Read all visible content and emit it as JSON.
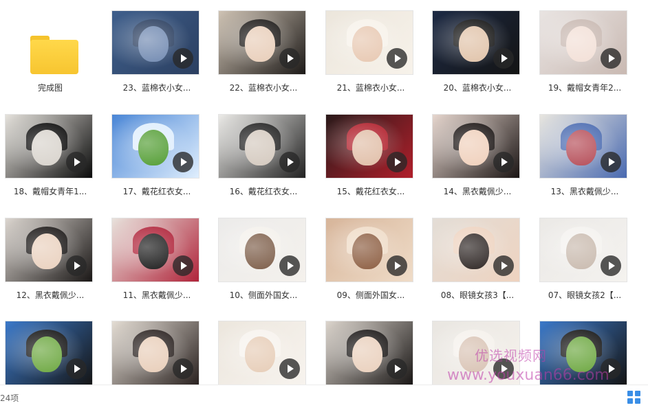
{
  "items": [
    {
      "label": "完成图",
      "kind": "folder",
      "icon": "folder-icon",
      "colors": [
        "#ffd84a"
      ]
    },
    {
      "label": "23、蓝棉衣小女...",
      "kind": "video",
      "icon": "play-icon",
      "colors": [
        "#3f5f8c",
        "#6f88b0",
        "#2b3f60"
      ]
    },
    {
      "label": "22、蓝棉衣小女...",
      "kind": "video",
      "icon": "play-icon",
      "colors": [
        "#cfc3b4",
        "#e8cdb8",
        "#1d1a18"
      ]
    },
    {
      "label": "21、蓝棉衣小女...",
      "kind": "video",
      "icon": "play-icon",
      "colors": [
        "#ece6dc",
        "#e7c7b0",
        "#f7f2ea"
      ]
    },
    {
      "label": "20、蓝棉衣小女...",
      "kind": "video",
      "icon": "play-icon",
      "colors": [
        "#1d2a44",
        "#e0c2a8",
        "#141414"
      ]
    },
    {
      "label": "19、戴帽女青年2...",
      "kind": "video",
      "icon": "play-icon",
      "colors": [
        "#e9e4e2",
        "#f2dfd6",
        "#c9b9b2"
      ]
    },
    {
      "label": "18、戴帽女青年1...",
      "kind": "video",
      "icon": "play-icon",
      "colors": [
        "#e6e3dd",
        "#d7d2cb",
        "#0b0b0b"
      ]
    },
    {
      "label": "17、戴花红衣女...",
      "kind": "video",
      "icon": "play-icon",
      "colors": [
        "#4a86d6",
        "#4f9b2f",
        "#dfeefd"
      ]
    },
    {
      "label": "16、戴花红衣女...",
      "kind": "video",
      "icon": "play-icon",
      "colors": [
        "#ecebe8",
        "#d3c8bd",
        "#222222"
      ]
    },
    {
      "label": "15、戴花红衣女...",
      "kind": "video",
      "icon": "play-icon",
      "colors": [
        "#2a1a1a",
        "#e0bda6",
        "#b01f2b"
      ]
    },
    {
      "label": "14、黑衣戴佩少...",
      "kind": "video",
      "icon": "play-icon",
      "colors": [
        "#e7d7cf",
        "#efcfba",
        "#1b1514"
      ]
    },
    {
      "label": "13、黑衣戴佩少...",
      "kind": "video",
      "icon": "play-icon",
      "colors": [
        "#e8e6e0",
        "#b44a55",
        "#4a6ab0"
      ]
    },
    {
      "label": "12、黑衣戴佩少...",
      "kind": "video",
      "icon": "play-icon",
      "colors": [
        "#dcd6d0",
        "#e9d0bd",
        "#1a1716"
      ]
    },
    {
      "label": "11、黑衣戴佩少...",
      "kind": "video",
      "icon": "play-icon",
      "colors": [
        "#e8e2dc",
        "#1a1a1a",
        "#b0243a"
      ]
    },
    {
      "label": "10、侧面外国女...",
      "kind": "video",
      "icon": "play-icon",
      "colors": [
        "#ecebea",
        "#7a5a45",
        "#f4f1ec"
      ]
    },
    {
      "label": "09、侧面外国女...",
      "kind": "video",
      "icon": "play-icon",
      "colors": [
        "#d7b59a",
        "#8a5a3d",
        "#efdcc8"
      ]
    },
    {
      "label": "08、眼镜女孩3【...",
      "kind": "video",
      "icon": "play-icon",
      "colors": [
        "#e3ddd6",
        "#2a2220",
        "#eed3c0"
      ]
    },
    {
      "label": "07、眼镜女孩2【...",
      "kind": "video",
      "icon": "play-icon",
      "colors": [
        "#ebe9e6",
        "#c8b9ad",
        "#f4f2ef"
      ]
    },
    {
      "label": "",
      "kind": "video",
      "icon": "play-icon",
      "colors": [
        "#3b79c9",
        "#6aa63d",
        "#151515"
      ]
    },
    {
      "label": "",
      "kind": "video",
      "icon": "play-icon",
      "colors": [
        "#e4ddd4",
        "#e8cdb8",
        "#2a2220"
      ]
    },
    {
      "label": "",
      "kind": "video",
      "icon": "play-icon",
      "colors": [
        "#ece6dd",
        "#e6ccb6",
        "#f7f3ee"
      ]
    },
    {
      "label": "",
      "kind": "video",
      "icon": "play-icon",
      "colors": [
        "#dcd5cd",
        "#e9cfbb",
        "#1a1716"
      ]
    },
    {
      "label": "",
      "kind": "video",
      "icon": "play-icon",
      "colors": [
        "#e9e6e1",
        "#d8c2b3",
        "#f5f1ec"
      ]
    },
    {
      "label": "",
      "kind": "video",
      "icon": "play-icon",
      "colors": [
        "#3b79c9",
        "#6aa63d",
        "#151515"
      ]
    }
  ],
  "status": {
    "count": "24项",
    "view_icon": "grid-view-icon"
  },
  "watermark": {
    "cn": "优选视频网",
    "url": "www.youxuan66.com"
  }
}
